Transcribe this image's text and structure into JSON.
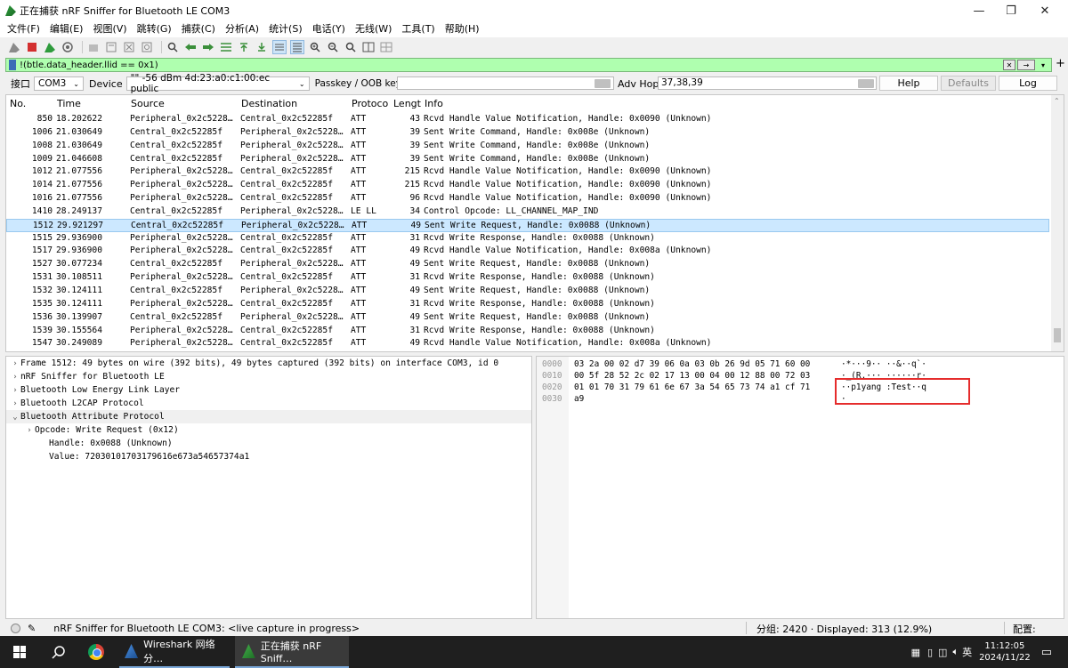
{
  "window": {
    "title": "正在捕获 nRF Sniffer for Bluetooth LE COM3",
    "controls": [
      "—",
      "❐",
      "✕"
    ]
  },
  "menu": [
    "文件(F)",
    "编辑(E)",
    "视图(V)",
    "跳转(G)",
    "捕获(C)",
    "分析(A)",
    "统计(S)",
    "电话(Y)",
    "无线(W)",
    "工具(T)",
    "帮助(H)"
  ],
  "filter": {
    "value": "!(btle.data_header.llid == 0x1)"
  },
  "interface": {
    "label": "接口",
    "port": "COM3",
    "device_label": "Device",
    "device_value": "\"\" -56 dBm 4d:23:a0:c1:00:ec public",
    "passkey_label": "Passkey / OOB key",
    "adv_hop_label": "Adv Hop",
    "adv_hop_value": "37,38,39",
    "help": "Help",
    "defaults": "Defaults",
    "log": "Log"
  },
  "packet_list": {
    "columns": [
      "No.",
      "Time",
      "Source",
      "Destination",
      "Protoco",
      "Lengt",
      "Info"
    ],
    "selected_index": 8,
    "rows": [
      {
        "no": "850",
        "time": "18.202622",
        "src": "Peripheral_0x2c5228…",
        "dst": "Central_0x2c52285f",
        "proto": "ATT",
        "len": "43",
        "info": "Rcvd Handle Value Notification, Handle: 0x0090 (Unknown)"
      },
      {
        "no": "1006",
        "time": "21.030649",
        "src": "Central_0x2c52285f",
        "dst": "Peripheral_0x2c5228…",
        "proto": "ATT",
        "len": "39",
        "info": "Sent Write Command, Handle: 0x008e (Unknown)"
      },
      {
        "no": "1008",
        "time": "21.030649",
        "src": "Central_0x2c52285f",
        "dst": "Peripheral_0x2c5228…",
        "proto": "ATT",
        "len": "39",
        "info": "Sent Write Command, Handle: 0x008e (Unknown)"
      },
      {
        "no": "1009",
        "time": "21.046608",
        "src": "Central_0x2c52285f",
        "dst": "Peripheral_0x2c5228…",
        "proto": "ATT",
        "len": "39",
        "info": "Sent Write Command, Handle: 0x008e (Unknown)"
      },
      {
        "no": "1012",
        "time": "21.077556",
        "src": "Peripheral_0x2c5228…",
        "dst": "Central_0x2c52285f",
        "proto": "ATT",
        "len": "215",
        "info": "Rcvd Handle Value Notification, Handle: 0x0090 (Unknown)"
      },
      {
        "no": "1014",
        "time": "21.077556",
        "src": "Peripheral_0x2c5228…",
        "dst": "Central_0x2c52285f",
        "proto": "ATT",
        "len": "215",
        "info": "Rcvd Handle Value Notification, Handle: 0x0090 (Unknown)"
      },
      {
        "no": "1016",
        "time": "21.077556",
        "src": "Peripheral_0x2c5228…",
        "dst": "Central_0x2c52285f",
        "proto": "ATT",
        "len": "96",
        "info": "Rcvd Handle Value Notification, Handle: 0x0090 (Unknown)"
      },
      {
        "no": "1410",
        "time": "28.249137",
        "src": "Central_0x2c52285f",
        "dst": "Peripheral_0x2c5228…",
        "proto": "LE LL",
        "len": "34",
        "info": "Control Opcode: LL_CHANNEL_MAP_IND"
      },
      {
        "no": "1512",
        "time": "29.921297",
        "src": "Central_0x2c52285f",
        "dst": "Peripheral_0x2c5228…",
        "proto": "ATT",
        "len": "49",
        "info": "Sent Write Request, Handle: 0x0088 (Unknown)"
      },
      {
        "no": "1515",
        "time": "29.936900",
        "src": "Peripheral_0x2c5228…",
        "dst": "Central_0x2c52285f",
        "proto": "ATT",
        "len": "31",
        "info": "Rcvd Write Response, Handle: 0x0088 (Unknown)"
      },
      {
        "no": "1517",
        "time": "29.936900",
        "src": "Peripheral_0x2c5228…",
        "dst": "Central_0x2c52285f",
        "proto": "ATT",
        "len": "49",
        "info": "Rcvd Handle Value Notification, Handle: 0x008a (Unknown)"
      },
      {
        "no": "1527",
        "time": "30.077234",
        "src": "Central_0x2c52285f",
        "dst": "Peripheral_0x2c5228…",
        "proto": "ATT",
        "len": "49",
        "info": "Sent Write Request, Handle: 0x0088 (Unknown)"
      },
      {
        "no": "1531",
        "time": "30.108511",
        "src": "Peripheral_0x2c5228…",
        "dst": "Central_0x2c52285f",
        "proto": "ATT",
        "len": "31",
        "info": "Rcvd Write Response, Handle: 0x0088 (Unknown)"
      },
      {
        "no": "1532",
        "time": "30.124111",
        "src": "Central_0x2c52285f",
        "dst": "Peripheral_0x2c5228…",
        "proto": "ATT",
        "len": "49",
        "info": "Sent Write Request, Handle: 0x0088 (Unknown)"
      },
      {
        "no": "1535",
        "time": "30.124111",
        "src": "Peripheral_0x2c5228…",
        "dst": "Central_0x2c52285f",
        "proto": "ATT",
        "len": "31",
        "info": "Rcvd Write Response, Handle: 0x0088 (Unknown)"
      },
      {
        "no": "1536",
        "time": "30.139907",
        "src": "Central_0x2c52285f",
        "dst": "Peripheral_0x2c5228…",
        "proto": "ATT",
        "len": "49",
        "info": "Sent Write Request, Handle: 0x0088 (Unknown)"
      },
      {
        "no": "1539",
        "time": "30.155564",
        "src": "Peripheral_0x2c5228…",
        "dst": "Central_0x2c52285f",
        "proto": "ATT",
        "len": "31",
        "info": "Rcvd Write Response, Handle: 0x0088 (Unknown)"
      },
      {
        "no": "1547",
        "time": "30.249089",
        "src": "Peripheral_0x2c5228…",
        "dst": "Central_0x2c52285f",
        "proto": "ATT",
        "len": "49",
        "info": "Rcvd Handle Value Notification, Handle: 0x008a (Unknown)"
      }
    ]
  },
  "details": {
    "lines": [
      {
        "twisty": "›",
        "text": "Frame 1512: 49 bytes on wire (392 bits), 49 bytes captured (392 bits) on interface COM3, id 0",
        "indent": 0
      },
      {
        "twisty": "›",
        "text": "nRF Sniffer for Bluetooth LE",
        "indent": 0
      },
      {
        "twisty": "›",
        "text": "Bluetooth Low Energy Link Layer",
        "indent": 0
      },
      {
        "twisty": "›",
        "text": "Bluetooth L2CAP Protocol",
        "indent": 0
      },
      {
        "twisty": "⌄",
        "text": "Bluetooth Attribute Protocol",
        "indent": 0
      },
      {
        "twisty": "›",
        "text": "Opcode: Write Request (0x12)",
        "indent": 1
      },
      {
        "twisty": "",
        "text": "Handle: 0x0088 (Unknown)",
        "indent": 2
      },
      {
        "twisty": "",
        "text": "Value: 72030101703179616e673a54657374a1",
        "indent": 2
      }
    ]
  },
  "bytes": {
    "rows": [
      {
        "offset": "0000",
        "hex": "03 2a 00 02 d7 39 06 0a  03 0b 26 9d 05 71 60 00",
        "ascii": "·*···9·· ··&··q`·"
      },
      {
        "offset": "0010",
        "hex": "00 5f 28 52 2c 02 17 13  00 04 00 12 88 00 72 03",
        "ascii": "·_(R,··· ······r·"
      },
      {
        "offset": "0020",
        "hex": "01 01 70 31 79 61 6e 67  3a 54 65 73 74 a1 cf 71",
        "ascii": "··p1yang :Test··q"
      },
      {
        "offset": "0030",
        "hex": "a9",
        "ascii": "·"
      }
    ]
  },
  "status": {
    "capture": "nRF Sniffer for Bluetooth LE COM3: <live capture in progress>",
    "packets": "分组: 2420 · Displayed: 313 (12.9%)",
    "profile": "配置: Default"
  },
  "taskbar": {
    "items": [
      "Wireshark 网络分…",
      "正在捕获 nRF Sniff…"
    ],
    "lang": "英",
    "time": "11:12:05",
    "date": "2024/11/22"
  },
  "colors": {
    "filter_bg": "#afffaf",
    "selected_row": "#cce8ff",
    "highlight_box": "#e52c2c"
  }
}
